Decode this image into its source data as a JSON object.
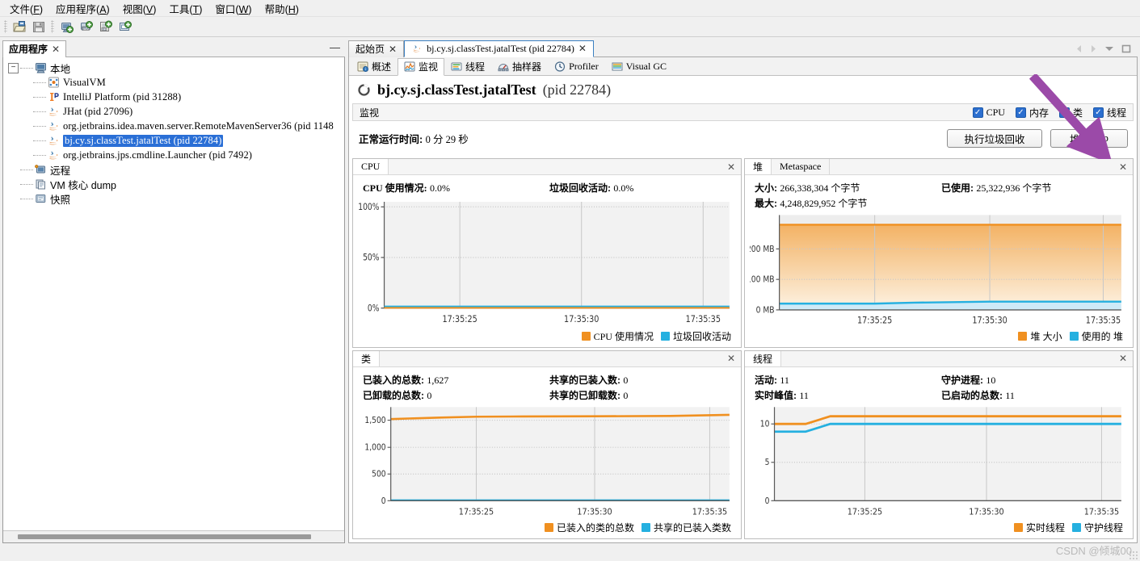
{
  "menubar": [
    {
      "label": "文件",
      "mnemonic": "F"
    },
    {
      "label": "应用程序",
      "mnemonic": "A"
    },
    {
      "label": "视图",
      "mnemonic": "V"
    },
    {
      "label": "工具",
      "mnemonic": "T"
    },
    {
      "label": "窗口",
      "mnemonic": "W"
    },
    {
      "label": "帮助",
      "mnemonic": "H"
    }
  ],
  "toolbar": {
    "buttons": [
      {
        "name": "open-file-icon",
        "title": "打开"
      },
      {
        "name": "save-file-icon",
        "title": "保存"
      },
      {
        "name": "add-local-host-icon",
        "title": "添加本地主机"
      },
      {
        "name": "add-jmx-connection-icon",
        "title": "添加 JMX 连接"
      },
      {
        "name": "add-remote-host-icon",
        "title": "添加远程主机"
      },
      {
        "name": "add-vm-coredump-icon",
        "title": "添加 VM 核心 dump"
      }
    ]
  },
  "sidebar": {
    "tab_title": "应用程序",
    "close_label": "✕",
    "minimize_label": "—",
    "tree": [
      {
        "label": "本地",
        "level": 0,
        "icon": "computer-icon",
        "expander": "-",
        "selected": false,
        "mono": false
      },
      {
        "label": "VisualVM",
        "level": 1,
        "icon": "visualvm-icon",
        "selected": false,
        "mono": true
      },
      {
        "label": "IntelliJ Platform (pid 31288)",
        "level": 1,
        "icon": "intellij-icon",
        "selected": false,
        "mono": true
      },
      {
        "label": "JHat (pid 27096)",
        "level": 1,
        "icon": "java-icon",
        "selected": false,
        "mono": true
      },
      {
        "label": "org.jetbrains.idea.maven.server.RemoteMavenServer36 (pid 1148",
        "level": 1,
        "icon": "java-icon",
        "selected": false,
        "mono": true
      },
      {
        "label": "bj.cy.sj.classTest.jatalTest (pid 22784)",
        "level": 1,
        "icon": "java-icon",
        "selected": true,
        "mono": true
      },
      {
        "label": "org.jetbrains.jps.cmdline.Launcher (pid 7492)",
        "level": 1,
        "icon": "java-icon",
        "selected": false,
        "mono": true
      },
      {
        "label": "远程",
        "level": 0,
        "icon": "remote-icon",
        "selected": false,
        "mono": false
      },
      {
        "label": "VM 核心 dump",
        "level": 0,
        "icon": "coredump-icon",
        "selected": false,
        "mono": false
      },
      {
        "label": "快照",
        "level": 0,
        "icon": "snapshot-icon",
        "selected": false,
        "mono": false
      }
    ]
  },
  "editor_tabs": {
    "tabs": [
      {
        "label": "起始页",
        "active": false,
        "icon": null,
        "mono": false
      },
      {
        "label": "bj.cy.sj.classTest.jatalTest (pid 22784)",
        "active": true,
        "icon": "java-icon",
        "mono": true
      }
    ],
    "close_label": "✕",
    "controls": [
      "prev-icon",
      "next-icon",
      "tab-list-icon",
      "maximize-icon"
    ]
  },
  "subtabs": [
    {
      "label": "概述",
      "icon": "overview-icon",
      "active": false,
      "mono": false
    },
    {
      "label": "监视",
      "icon": "monitor-icon",
      "active": true,
      "mono": false
    },
    {
      "label": "线程",
      "icon": "threads-icon",
      "active": false,
      "mono": false
    },
    {
      "label": "抽样器",
      "icon": "sampler-icon",
      "active": false,
      "mono": false
    },
    {
      "label": "Profiler",
      "icon": "profiler-icon",
      "active": false,
      "mono": true
    },
    {
      "label": "Visual GC",
      "icon": "visualgc-icon",
      "active": false,
      "mono": true
    }
  ],
  "app_header": {
    "icon": "process-ring-icon",
    "title": "bj.cy.sj.classTest.jatalTest",
    "pid": "(pid 22784)"
  },
  "monitor": {
    "section_title": "监视",
    "checkboxes": [
      {
        "label": "CPU",
        "checked": true,
        "mono": true
      },
      {
        "label": "内存",
        "checked": true,
        "mono": false
      },
      {
        "label": "类",
        "checked": true,
        "mono": false
      },
      {
        "label": "线程",
        "checked": true,
        "mono": false
      }
    ],
    "uptime_label": "正常运行时间:",
    "uptime_value": "0 分 29 秒",
    "buttons": [
      {
        "label": "执行垃圾回收",
        "name": "perform-gc-button"
      },
      {
        "label": "堆 Dump",
        "label_cn": "堆",
        "label_mono": "Dump",
        "name": "heap-dump-button"
      }
    ]
  },
  "colors": {
    "orange": "#f09020",
    "orange_fill_top": "#f3b264",
    "orange_fill_bottom": "#fdf0de",
    "blue": "#25b0e0",
    "blue_fill": "#bfe8f7",
    "plot_bg": "#f2f2f2",
    "grid": "#c8c8c8",
    "axis": "#5a5a5a",
    "selection": "#2a6fd6",
    "arrow": "#9b4aa8"
  },
  "chart_data": [
    {
      "type": "area",
      "panel_id": "cpu",
      "panel_title": "CPU",
      "title": "",
      "stats": [
        {
          "key": "CPU 使用情况:",
          "value": "0.0%",
          "mono_key": true
        },
        {
          "key": "垃圾回收活动:",
          "value": "0.0%",
          "mono_key": false
        }
      ],
      "x": [
        "17:35:23",
        "17:35:25",
        "17:35:27",
        "17:35:30",
        "17:35:32",
        "17:35:35",
        "17:35:37"
      ],
      "xticks": [
        "17:35:25",
        "17:35:30",
        "17:35:35"
      ],
      "yticks": [
        "100%",
        "50%",
        "0%"
      ],
      "ylim": [
        0,
        100
      ],
      "ylabel": "",
      "xlabel": "",
      "grid": true,
      "series": [
        {
          "name": "CPU 使用情况",
          "color": "#f09020",
          "values": [
            0,
            0,
            0,
            0,
            0,
            0,
            0
          ]
        },
        {
          "name": "垃圾回收活动",
          "color": "#25b0e0",
          "values": [
            0,
            0,
            0,
            0,
            0,
            0,
            0
          ]
        }
      ],
      "legend": [
        "CPU 使用情况",
        "垃圾回收活动"
      ],
      "legend_position": "bottom-right"
    },
    {
      "type": "area",
      "panel_id": "heap",
      "panel_title": "堆",
      "panel_tabs": [
        "堆",
        "Metaspace"
      ],
      "title": "",
      "stats": [
        {
          "key": "大小:",
          "value": "266,338,304 个字节",
          "mono_key": false
        },
        {
          "key": "已使用:",
          "value": "25,322,936 个字节",
          "mono_key": false
        },
        {
          "key": "最大:",
          "value": "4,248,829,952 个字节",
          "mono_key": false
        }
      ],
      "x": [
        "17:35:23",
        "17:35:25",
        "17:35:27",
        "17:35:30",
        "17:35:32",
        "17:35:35",
        "17:35:37"
      ],
      "xticks": [
        "17:35:25",
        "17:35:30",
        "17:35:35"
      ],
      "yticks": [
        "200 MB",
        "100 MB",
        "0 MB"
      ],
      "ylim": [
        0,
        266
      ],
      "yunit": "MB",
      "grid": true,
      "series": [
        {
          "name": "堆 大小",
          "color": "#f09020",
          "values": [
            254,
            254,
            254,
            254,
            254,
            254,
            254
          ]
        },
        {
          "name": "使用的 堆",
          "color": "#25b0e0",
          "values": [
            20,
            20,
            21,
            24,
            24,
            24,
            24
          ]
        }
      ],
      "legend": [
        "堆 大小",
        "使用的 堆"
      ],
      "legend_position": "bottom-right"
    },
    {
      "type": "line",
      "panel_id": "classes",
      "panel_title": "类",
      "title": "",
      "stats": [
        {
          "key": "已装入的总数:",
          "value": "1,627",
          "mono_key": false
        },
        {
          "key": "共享的已装入数:",
          "value": "0",
          "mono_key": false
        },
        {
          "key": "已卸载的总数:",
          "value": "0",
          "mono_key": false
        },
        {
          "key": "共享的已卸载数:",
          "value": "0",
          "mono_key": false
        }
      ],
      "x": [
        "17:35:23",
        "17:35:25",
        "17:35:27",
        "17:35:30",
        "17:35:32",
        "17:35:35",
        "17:35:37"
      ],
      "xticks": [
        "17:35:25",
        "17:35:30",
        "17:35:35"
      ],
      "yticks": [
        "1,500",
        "1,000",
        "500",
        "0"
      ],
      "ylim": [
        0,
        1750
      ],
      "grid": true,
      "series": [
        {
          "name": "已装入的类的总数",
          "color": "#f09020",
          "values": [
            1560,
            1585,
            1600,
            1605,
            1608,
            1615,
            1627
          ]
        },
        {
          "name": "共享的已装入类数",
          "color": "#25b0e0",
          "values": [
            0,
            0,
            0,
            0,
            0,
            0,
            0
          ]
        }
      ],
      "legend": [
        "已装入的类的总数",
        "共享的已装入类数"
      ],
      "legend_position": "bottom-right"
    },
    {
      "type": "line",
      "panel_id": "threads",
      "panel_title": "线程",
      "title": "",
      "stats": [
        {
          "key": "活动:",
          "value": "11",
          "mono_key": false
        },
        {
          "key": "守护进程:",
          "value": "10",
          "mono_key": false
        },
        {
          "key": "实时峰值:",
          "value": "11",
          "mono_key": false
        },
        {
          "key": "已启动的总数:",
          "value": "11",
          "mono_key": false
        }
      ],
      "x": [
        "17:35:23",
        "17:35:24",
        "17:35:26",
        "17:35:30",
        "17:35:32",
        "17:35:35",
        "17:35:37"
      ],
      "xticks": [
        "17:35:25",
        "17:35:30",
        "17:35:35"
      ],
      "yticks": [
        "10",
        "5",
        "0"
      ],
      "ylim": [
        0,
        12.2
      ],
      "grid": true,
      "series": [
        {
          "name": "实时线程",
          "color": "#f09020",
          "values": [
            10,
            10,
            11,
            11,
            11,
            11,
            11
          ]
        },
        {
          "name": "守护线程",
          "color": "#25b0e0",
          "values": [
            9,
            9,
            10,
            10,
            10,
            10,
            10
          ]
        }
      ],
      "legend": [
        "实时线程",
        "守护线程"
      ],
      "legend_position": "bottom-right"
    }
  ],
  "annotation": {
    "type": "arrow",
    "color": "#9b4aa8",
    "points_to": "heap-dump-button"
  },
  "watermark": "CSDN @倾城00"
}
